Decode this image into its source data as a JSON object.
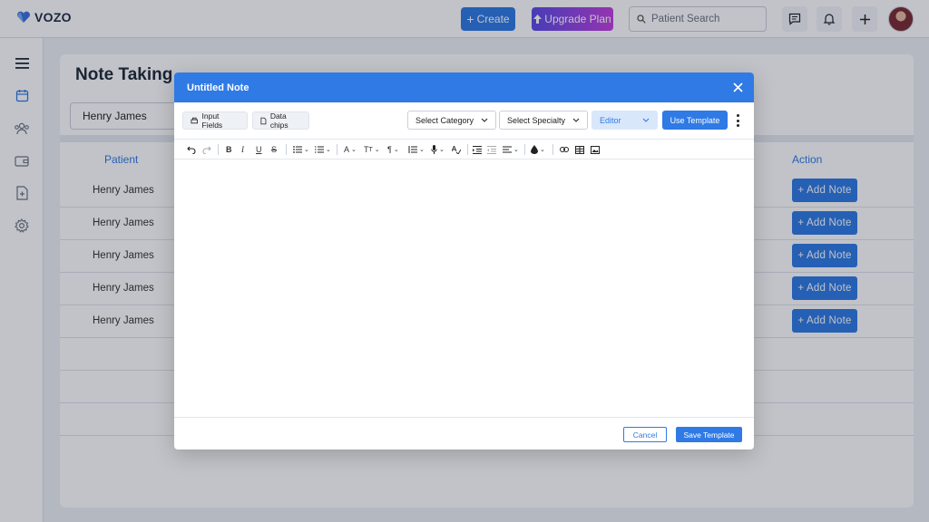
{
  "brand": {
    "name": "VOZO",
    "accent": "#2f7ae5"
  },
  "header": {
    "create_label": "Create",
    "upgrade_label": "Upgrade Plan",
    "search_placeholder": "Patient Search",
    "icons": [
      "chat-icon",
      "bell-icon",
      "plus-icon",
      "avatar"
    ]
  },
  "sidebar": {
    "icons": [
      "menu-icon",
      "calendar-icon",
      "users-icon",
      "wallet-icon",
      "document-plus-icon",
      "settings-icon"
    ]
  },
  "page": {
    "title": "Note Taking",
    "patient_filter_value": "Henry James",
    "columns": {
      "patient": "Patient",
      "action": "Action"
    },
    "rows": [
      {
        "patient": "Henry James",
        "action": "+ Add  Note"
      },
      {
        "patient": "Henry James",
        "action": "+ Add  Note"
      },
      {
        "patient": "Henry James",
        "action": "+ Add  Note"
      },
      {
        "patient": "Henry James",
        "action": "+ Add  Note"
      },
      {
        "patient": "Henry James",
        "action": "+ Add  Note"
      }
    ]
  },
  "modal": {
    "title": "Untitled Note",
    "toolbar": {
      "input_fields": "Input Fields",
      "data_chips": "Data chips",
      "category_placeholder": "Select Category",
      "specialty_placeholder": "Select Specialty",
      "editor_mode": "Editor",
      "use_template": "Use Template"
    },
    "format_tools": [
      "undo",
      "redo",
      "bold",
      "italic",
      "underline",
      "strikethrough",
      "bullet-list",
      "numbered-list",
      "font-color",
      "text-size",
      "paragraph",
      "line-height",
      "microphone",
      "spellcheck",
      "indent",
      "outdent",
      "align",
      "fill-color",
      "link",
      "table",
      "image"
    ],
    "footer": {
      "cancel": "Cancel",
      "save": "Save Template"
    }
  }
}
